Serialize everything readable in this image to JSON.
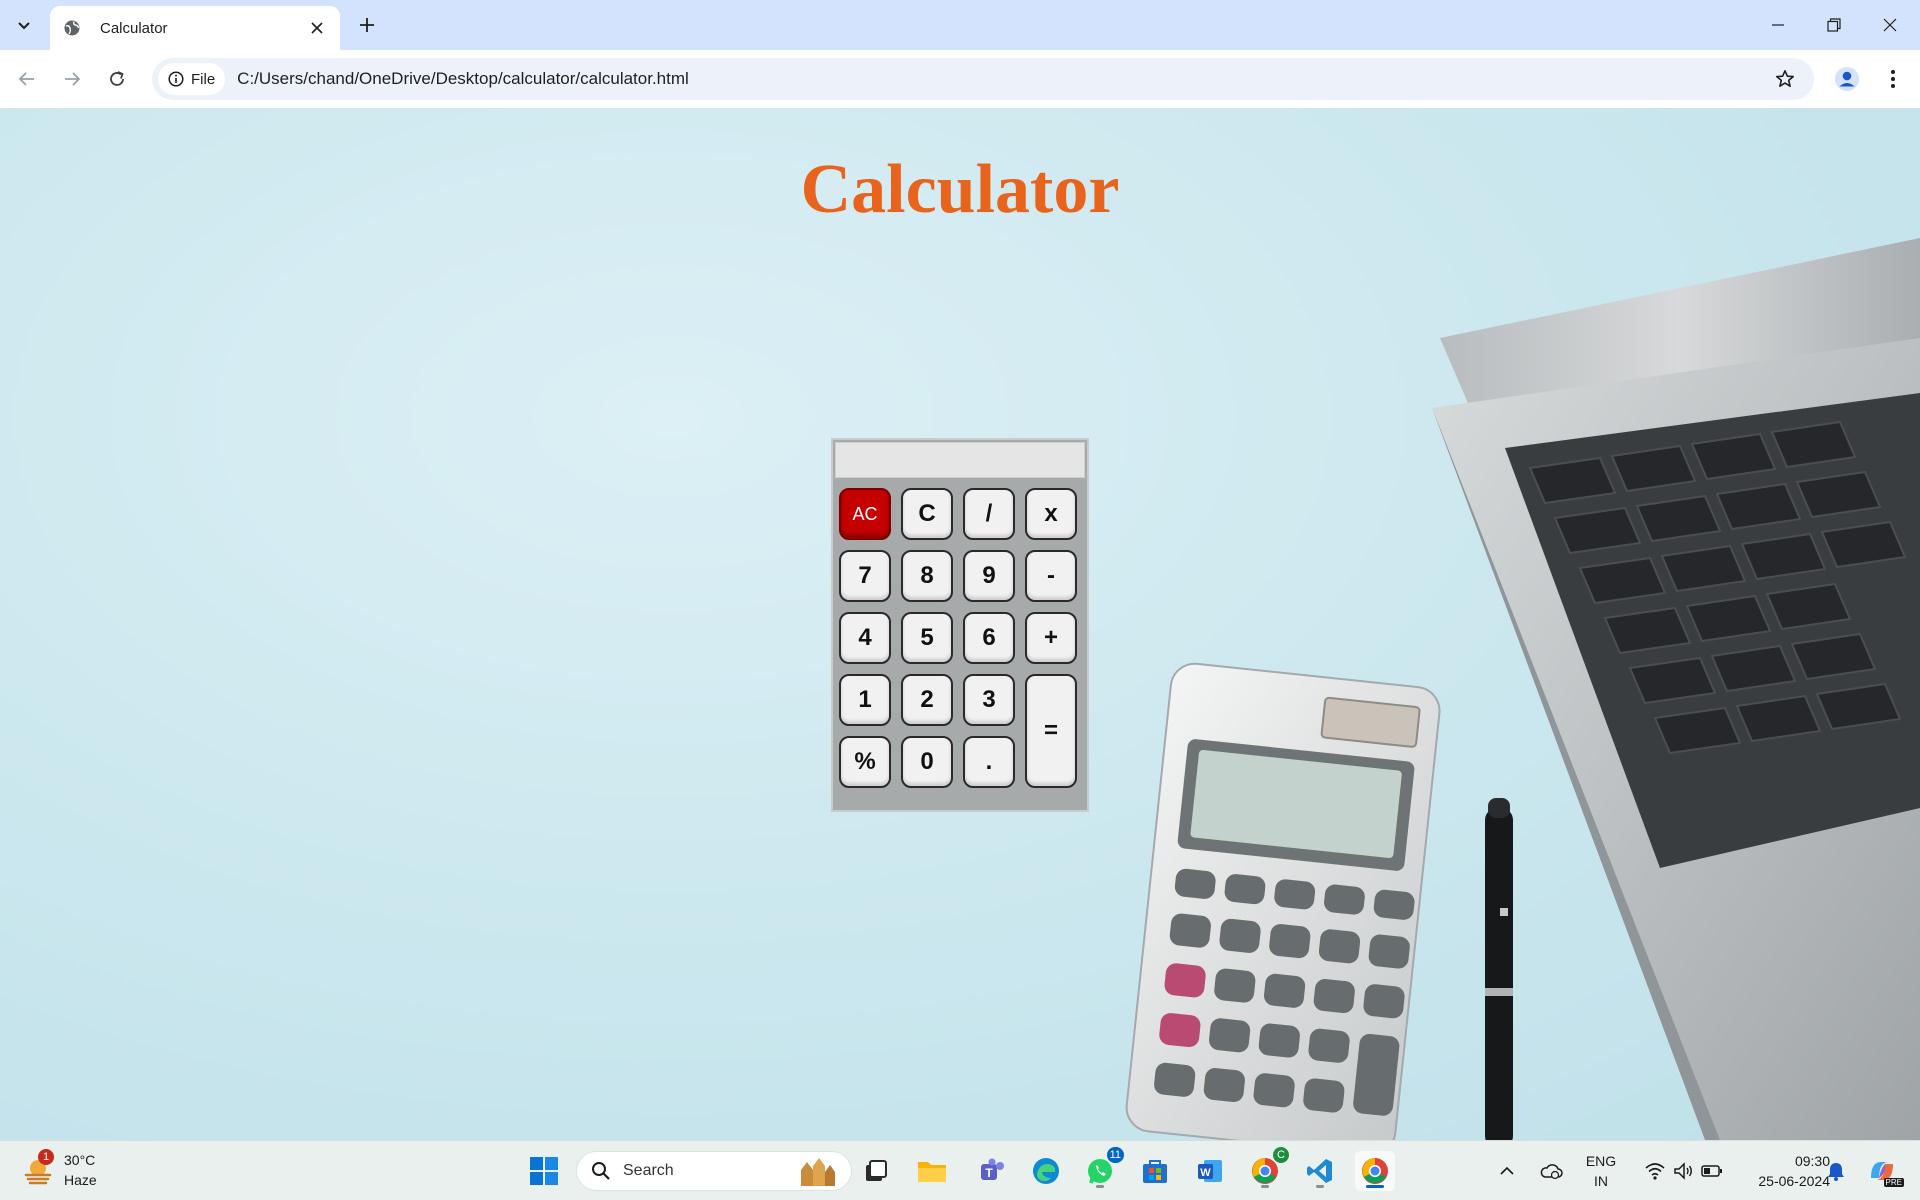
{
  "browser": {
    "tab_title": "Calculator",
    "site_chip_label": "File",
    "url": "C:/Users/chand/OneDrive/Desktop/calculator/calculator.html"
  },
  "page": {
    "heading": "Calculator",
    "display_value": "",
    "keys": {
      "ac": "AC",
      "clear": "C",
      "divide": "/",
      "multiply": "x",
      "seven": "7",
      "eight": "8",
      "nine": "9",
      "minus": "-",
      "four": "4",
      "five": "5",
      "six": "6",
      "plus": "+",
      "one": "1",
      "two": "2",
      "three": "3",
      "equals": "=",
      "percent": "%",
      "zero": "0",
      "dot": "."
    },
    "colors": {
      "heading": "#e8631c",
      "ac_key": "#c40000",
      "calc_body": "#a7aaab"
    }
  },
  "taskbar": {
    "weather_badge": "1",
    "temperature": "30°C",
    "condition": "Haze",
    "search_placeholder": "Search",
    "whatsapp_badge": "11",
    "chrome_canary_badge": "C",
    "language": "ENG",
    "region": "IN",
    "time": "09:30",
    "date": "25-06-2024",
    "copilot_label": "PRE"
  }
}
